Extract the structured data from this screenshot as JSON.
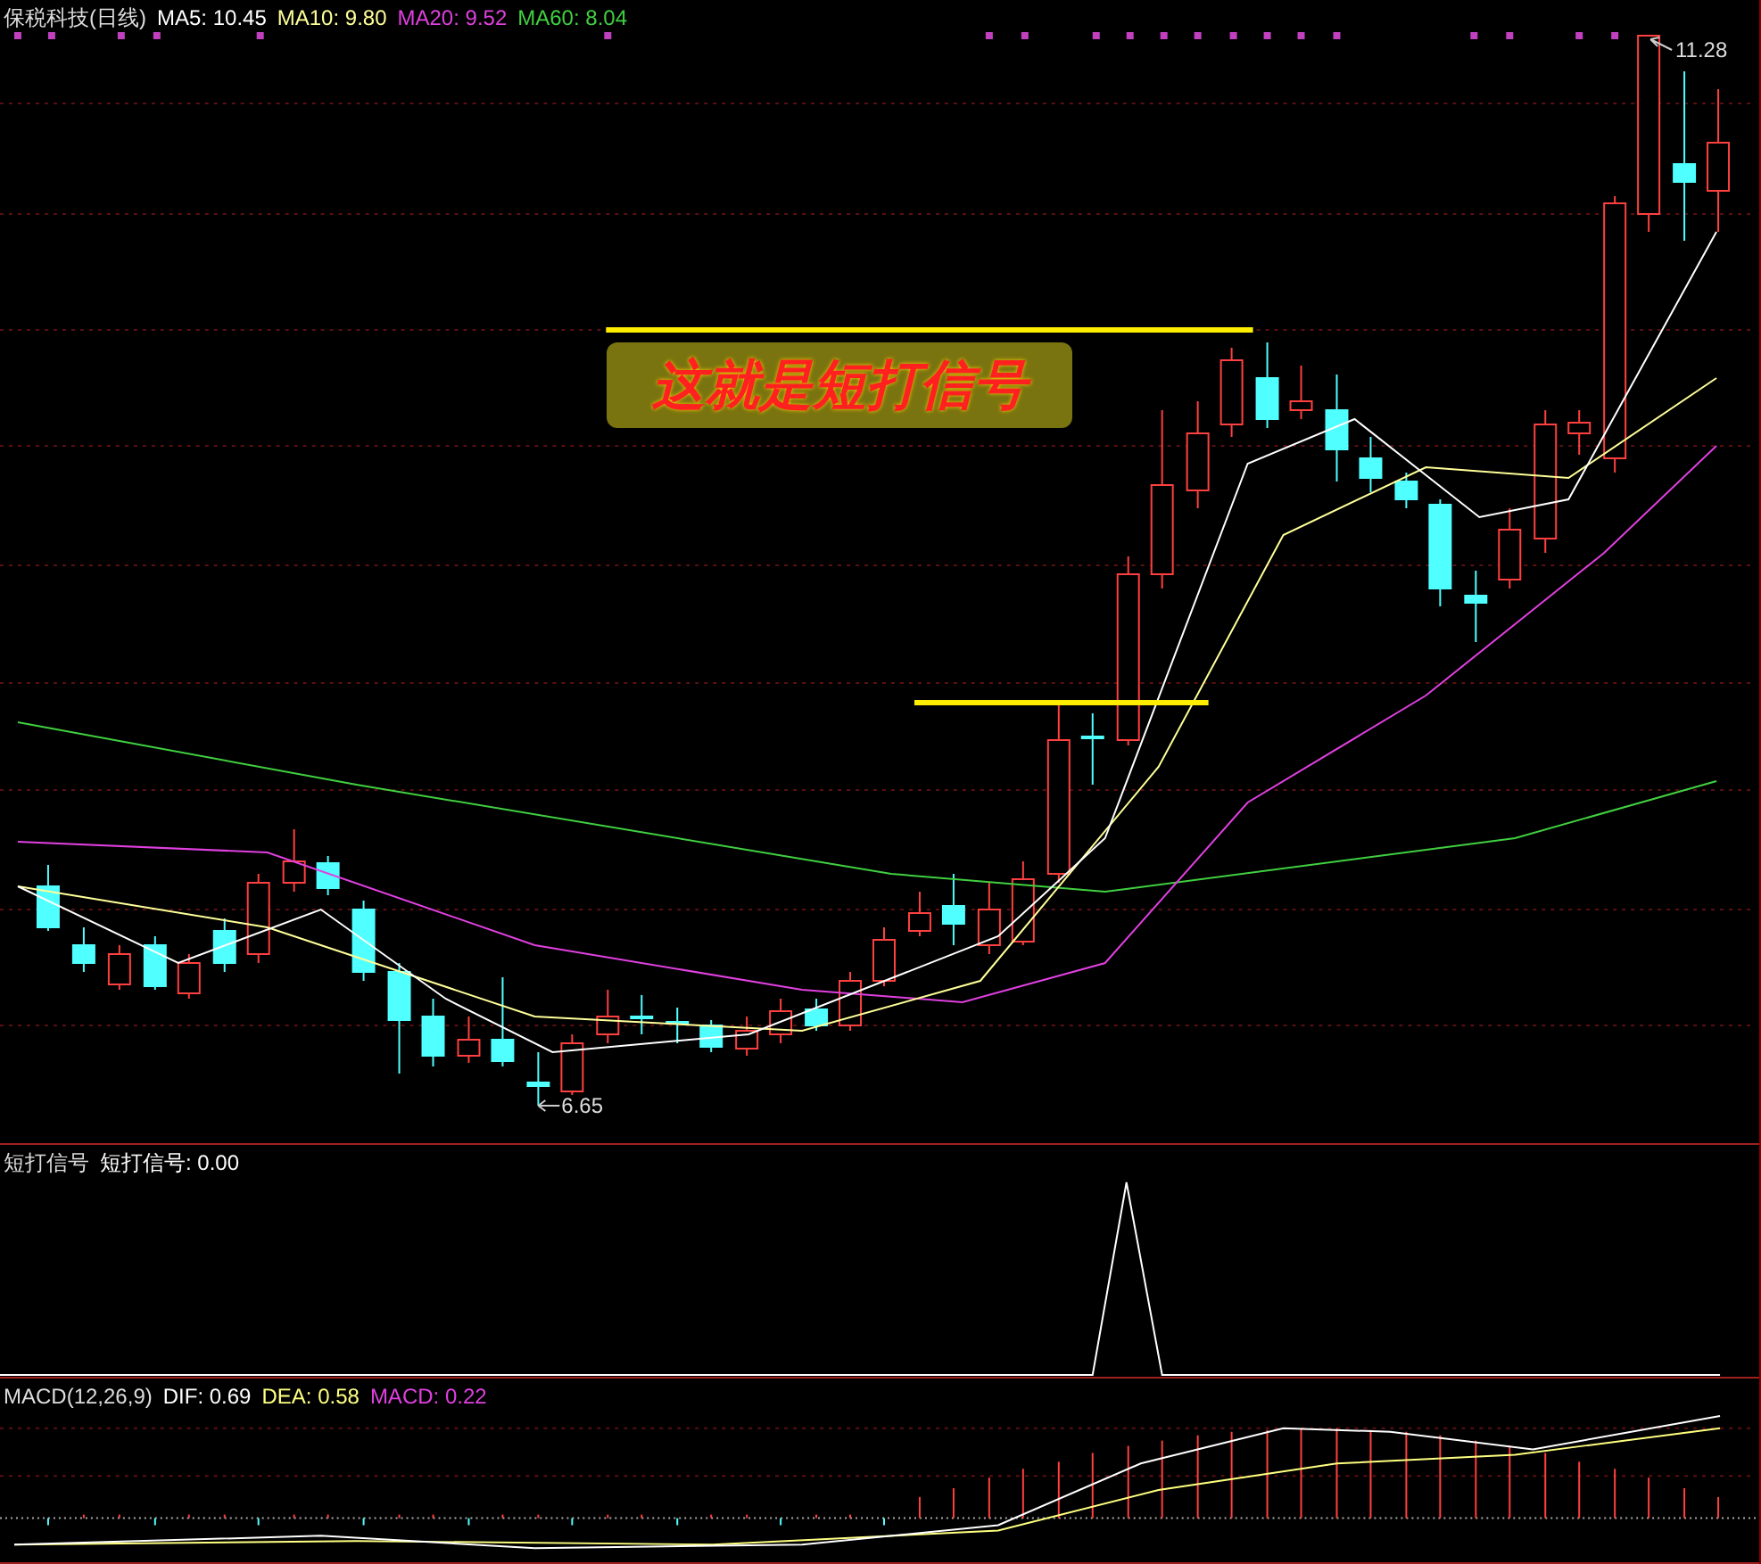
{
  "main_panel": {
    "stock": "保税科技(日线)",
    "indicators": [
      {
        "label": "MA5: 10.45",
        "color": "#ffffff"
      },
      {
        "label": "MA10: 9.80",
        "color": "#ffff99"
      },
      {
        "label": "MA20: 9.52",
        "color": "#e040e0"
      },
      {
        "label": "MA60: 8.04",
        "color": "#40d040"
      }
    ],
    "high_label": "11.28",
    "low_label": "6.65",
    "annotation": "这就是短打信号"
  },
  "signal_panel": {
    "title": "短打信号",
    "reading": "短打信号: 0.00"
  },
  "macd_panel": {
    "title": "MACD(12,26,9)",
    "readings": [
      {
        "label": "DIF: 0.69",
        "color": "#ffffff"
      },
      {
        "label": "DEA: 0.58",
        "color": "#ffff80"
      },
      {
        "label": "MACD: 0.22",
        "color": "#e040e0"
      }
    ]
  }
}
